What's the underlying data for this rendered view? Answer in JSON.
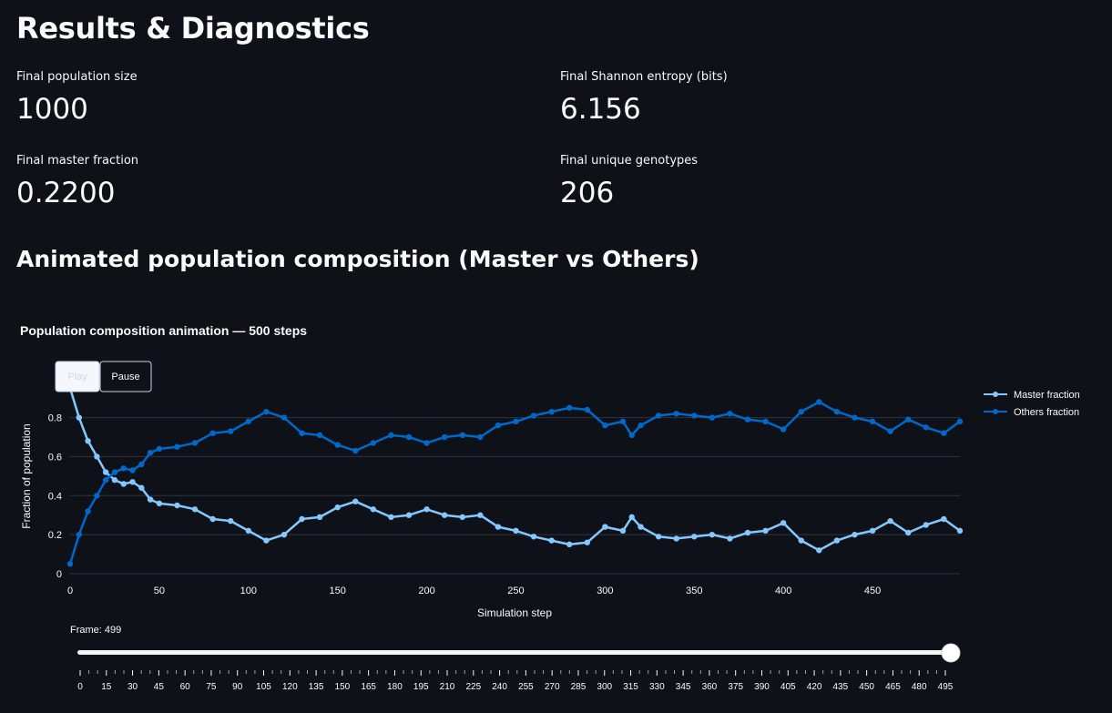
{
  "page": {
    "title": "Results & Diagnostics",
    "section_title": "Animated population composition (Master vs Others)"
  },
  "metrics": [
    {
      "label": "Final population size",
      "value": "1000"
    },
    {
      "label": "Final Shannon entropy (bits)",
      "value": "6.156"
    },
    {
      "label": "Final master fraction",
      "value": "0.2200"
    },
    {
      "label": "Final unique genotypes",
      "value": "206"
    }
  ],
  "controls": {
    "play_label": "Play",
    "pause_label": "Pause",
    "frame_label": "Frame: 499",
    "slider_value": 499,
    "slider_ticks": [
      0,
      15,
      30,
      45,
      60,
      75,
      90,
      105,
      120,
      135,
      150,
      165,
      180,
      195,
      210,
      225,
      240,
      255,
      270,
      285,
      300,
      315,
      330,
      345,
      360,
      375,
      390,
      405,
      420,
      435,
      450,
      465,
      480,
      495
    ]
  },
  "colors": {
    "background": "#0e1117",
    "master": "#83c9ff",
    "others": "#0068c9",
    "grid": "#31333f"
  },
  "chart_data": {
    "type": "line",
    "title": "Population composition animation — 500 steps",
    "xlabel": "Simulation step",
    "ylabel": "Fraction of population",
    "xlim": [
      0,
      499
    ],
    "ylim": [
      0,
      0.98
    ],
    "xticks": [
      0,
      50,
      100,
      150,
      200,
      250,
      300,
      350,
      400,
      450
    ],
    "yticks": [
      0,
      0.2,
      0.4,
      0.6,
      0.8
    ],
    "grid": true,
    "legend": "top-right",
    "series": [
      {
        "name": "Master fraction",
        "x": [
          0,
          5,
          10,
          15,
          20,
          25,
          30,
          35,
          40,
          45,
          50,
          60,
          70,
          80,
          90,
          100,
          110,
          120,
          130,
          140,
          150,
          160,
          170,
          180,
          190,
          200,
          210,
          220,
          230,
          240,
          250,
          260,
          270,
          280,
          290,
          300,
          310,
          315,
          320,
          330,
          340,
          350,
          360,
          370,
          380,
          390,
          400,
          410,
          420,
          430,
          440,
          450,
          460,
          470,
          480,
          490,
          499
        ],
        "values": [
          0.95,
          0.8,
          0.68,
          0.6,
          0.52,
          0.48,
          0.46,
          0.47,
          0.44,
          0.38,
          0.36,
          0.35,
          0.33,
          0.28,
          0.27,
          0.22,
          0.17,
          0.2,
          0.28,
          0.29,
          0.34,
          0.37,
          0.33,
          0.29,
          0.3,
          0.33,
          0.3,
          0.29,
          0.3,
          0.24,
          0.22,
          0.19,
          0.17,
          0.15,
          0.16,
          0.24,
          0.22,
          0.29,
          0.24,
          0.19,
          0.18,
          0.19,
          0.2,
          0.18,
          0.21,
          0.22,
          0.26,
          0.17,
          0.12,
          0.17,
          0.2,
          0.22,
          0.27,
          0.21,
          0.25,
          0.28,
          0.22
        ]
      },
      {
        "name": "Others fraction",
        "x": [
          0,
          5,
          10,
          15,
          20,
          25,
          30,
          35,
          40,
          45,
          50,
          60,
          70,
          80,
          90,
          100,
          110,
          120,
          130,
          140,
          150,
          160,
          170,
          180,
          190,
          200,
          210,
          220,
          230,
          240,
          250,
          260,
          270,
          280,
          290,
          300,
          310,
          315,
          320,
          330,
          340,
          350,
          360,
          370,
          380,
          390,
          400,
          410,
          420,
          430,
          440,
          450,
          460,
          470,
          480,
          490,
          499
        ],
        "values": [
          0.05,
          0.2,
          0.32,
          0.4,
          0.48,
          0.52,
          0.54,
          0.53,
          0.56,
          0.62,
          0.64,
          0.65,
          0.67,
          0.72,
          0.73,
          0.78,
          0.83,
          0.8,
          0.72,
          0.71,
          0.66,
          0.63,
          0.67,
          0.71,
          0.7,
          0.67,
          0.7,
          0.71,
          0.7,
          0.76,
          0.78,
          0.81,
          0.83,
          0.85,
          0.84,
          0.76,
          0.78,
          0.71,
          0.76,
          0.81,
          0.82,
          0.81,
          0.8,
          0.82,
          0.79,
          0.78,
          0.74,
          0.83,
          0.88,
          0.83,
          0.8,
          0.78,
          0.73,
          0.79,
          0.75,
          0.72,
          0.78
        ]
      }
    ]
  }
}
